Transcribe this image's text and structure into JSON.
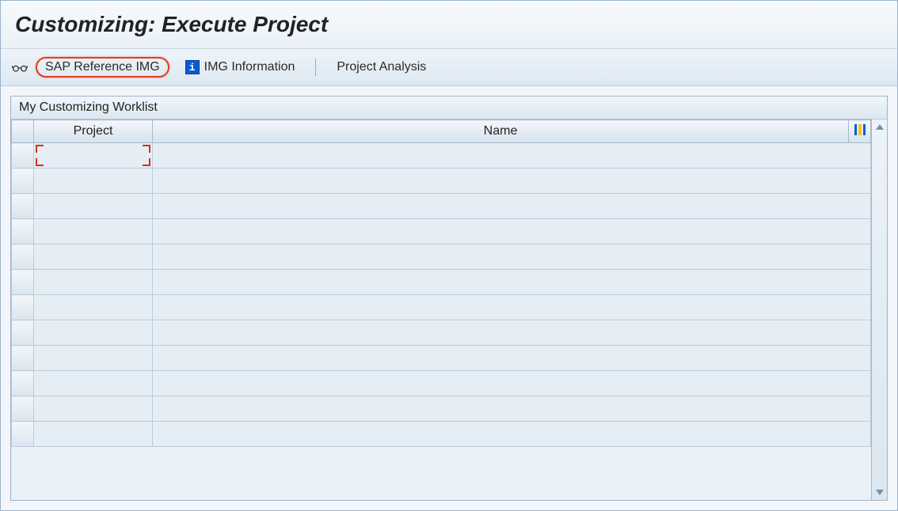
{
  "window": {
    "title": "Customizing: Execute Project"
  },
  "toolbar": {
    "sap_reference_img_label": "SAP Reference IMG",
    "img_information_label": "IMG Information",
    "project_analysis_label": "Project Analysis"
  },
  "panel": {
    "header": "My Customizing Worklist",
    "columns": {
      "project": "Project",
      "name": "Name"
    },
    "rows": [
      {
        "project": "",
        "name": ""
      },
      {
        "project": "",
        "name": ""
      },
      {
        "project": "",
        "name": ""
      },
      {
        "project": "",
        "name": ""
      },
      {
        "project": "",
        "name": ""
      },
      {
        "project": "",
        "name": ""
      },
      {
        "project": "",
        "name": ""
      },
      {
        "project": "",
        "name": ""
      },
      {
        "project": "",
        "name": ""
      },
      {
        "project": "",
        "name": ""
      },
      {
        "project": "",
        "name": ""
      },
      {
        "project": "",
        "name": ""
      }
    ]
  }
}
